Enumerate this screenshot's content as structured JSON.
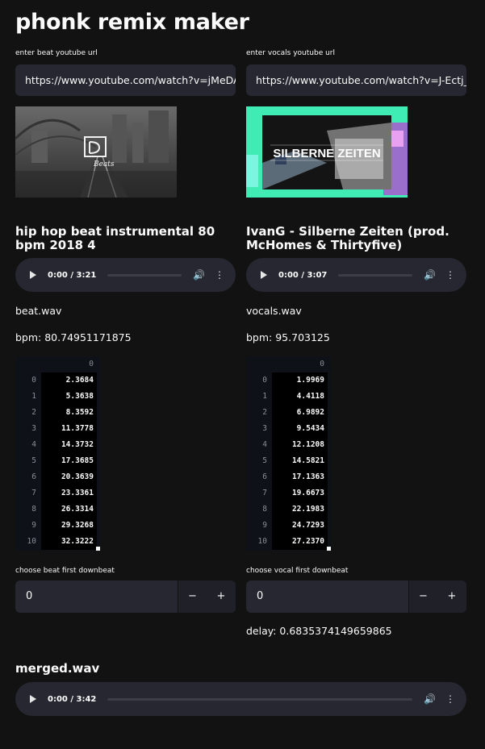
{
  "page": {
    "title": "phonk remix maker"
  },
  "beat": {
    "url_label": "enter beat youtube url",
    "url_value": "https://www.youtube.com/watch?v=jMeDA...",
    "thumbnail_label": "Beats",
    "video_title": "hip hop beat instrumental 80 bpm 2018 4",
    "audio": {
      "time": "0:00 / 3:21"
    },
    "file": "beat.wav",
    "bpm_text": "bpm: 80.74951171875",
    "table": {
      "header": "0",
      "rows": [
        {
          "idx": "0",
          "val": "2.3684"
        },
        {
          "idx": "1",
          "val": "5.3638"
        },
        {
          "idx": "2",
          "val": "8.3592"
        },
        {
          "idx": "3",
          "val": "11.3778"
        },
        {
          "idx": "4",
          "val": "14.3732"
        },
        {
          "idx": "5",
          "val": "17.3685"
        },
        {
          "idx": "6",
          "val": "20.3639"
        },
        {
          "idx": "7",
          "val": "23.3361"
        },
        {
          "idx": "8",
          "val": "26.3314"
        },
        {
          "idx": "9",
          "val": "29.3268"
        },
        {
          "idx": "10",
          "val": "32.3222"
        }
      ]
    },
    "downbeat_label": "choose beat first downbeat",
    "downbeat_value": "0"
  },
  "vocals": {
    "url_label": "enter vocals youtube url",
    "url_value": "https://www.youtube.com/watch?v=J-Ectj_",
    "thumbnail_label": "SILBERNE ZEITEN",
    "video_title": "IvanG - Silberne Zeiten (prod. McHomes & Thirtyfive)",
    "audio": {
      "time": "0:00 / 3:07"
    },
    "file": "vocals.wav",
    "bpm_text": "bpm: 95.703125",
    "table": {
      "header": "0",
      "rows": [
        {
          "idx": "0",
          "val": "1.9969"
        },
        {
          "idx": "1",
          "val": "4.4118"
        },
        {
          "idx": "2",
          "val": "6.9892"
        },
        {
          "idx": "3",
          "val": "9.5434"
        },
        {
          "idx": "4",
          "val": "12.1208"
        },
        {
          "idx": "5",
          "val": "14.5821"
        },
        {
          "idx": "6",
          "val": "17.1363"
        },
        {
          "idx": "7",
          "val": "19.6673"
        },
        {
          "idx": "8",
          "val": "22.1983"
        },
        {
          "idx": "9",
          "val": "24.7293"
        },
        {
          "idx": "10",
          "val": "27.2370"
        }
      ]
    },
    "downbeat_label": "choose vocal first downbeat",
    "downbeat_value": "0",
    "delay_text": "delay: 0.6835374149659865"
  },
  "merged": {
    "title": "merged.wav",
    "audio": {
      "time": "0:00 / 3:42"
    }
  },
  "controls": {
    "minus": "−",
    "plus": "+",
    "volume_icon": "🔊",
    "menu_icon": "⋮"
  },
  "colors": {
    "background": "#121212",
    "input_bg": "#262730",
    "text": "#fafafa",
    "table_index": "#8b8d96"
  }
}
